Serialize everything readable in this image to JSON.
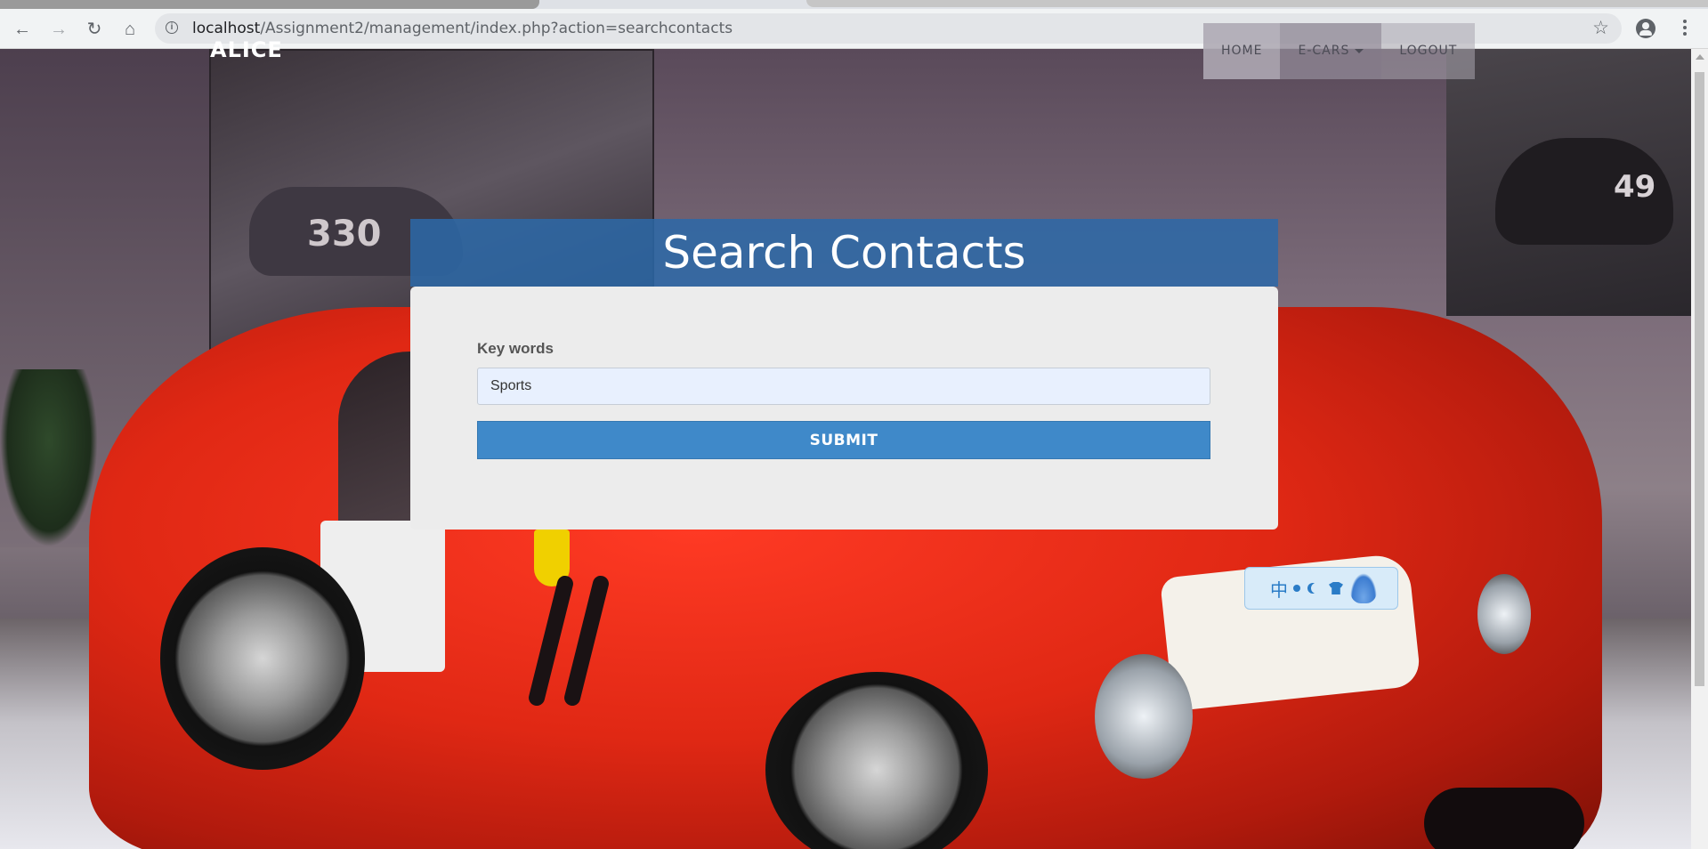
{
  "browser": {
    "url_host": "localhost",
    "url_path": "/Assignment2/management/index.php?action=searchcontacts"
  },
  "site": {
    "brand": "ALICE",
    "nav": {
      "home": "HOME",
      "ecars": "E-CARS",
      "logout": "LOGOUT"
    }
  },
  "background": {
    "left_photo_number": "330",
    "right_photo_number": "49"
  },
  "search": {
    "title": "Search Contacts",
    "label": "Key words",
    "value": "Sports",
    "submit": "SUBMIT"
  },
  "ime": {
    "char": "中"
  },
  "colors": {
    "panel_header": "#2c68a8",
    "submit_button": "#3f89c9",
    "panel_bg": "#ececec"
  }
}
